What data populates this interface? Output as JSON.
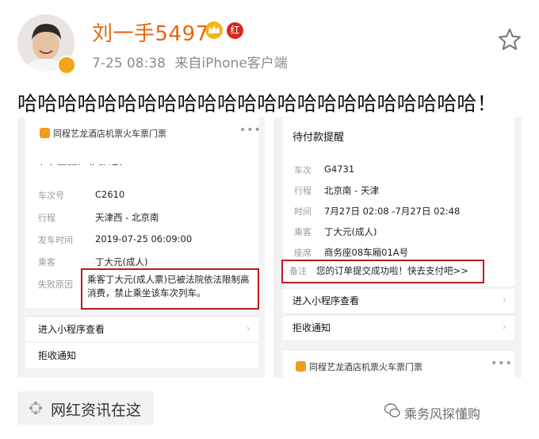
{
  "post": {
    "author_name": "刘一手5497",
    "red_badge": "红",
    "timestamp": "7-25 08:38",
    "source": "来自iPhone客户端",
    "text": "哈哈哈哈哈哈哈哈哈哈哈哈哈哈哈哈哈哈哈哈哈哈哈！"
  },
  "left_image": {
    "brand": "同程艺龙酒店机票火车票门票",
    "dots": "•••",
    "title": "火车票预订失败通知",
    "fields": [
      {
        "label": "车次号",
        "value": "C2610"
      },
      {
        "label": "行程",
        "value": "天津西 - 北京南"
      },
      {
        "label": "发车时间",
        "value": "2019-07-25 06:09:00"
      },
      {
        "label": "乘客",
        "value": "丁大元(成人)"
      },
      {
        "label": "失败原因",
        "value": "乘客丁大元(成人票)已被法院依法限制高消费，禁止乘坐该车次列车。"
      }
    ],
    "links": [
      "进入小程序查看",
      "拒收通知"
    ]
  },
  "right_image": {
    "title": "待付款提醒",
    "fields": [
      {
        "label": "车次",
        "value": "G4731"
      },
      {
        "label": "行程",
        "value": "北京南 - 天津"
      },
      {
        "label": "时间",
        "value": "7月27日 02:08 -7月27日 02:48"
      },
      {
        "label": "乘客",
        "value": "丁大元(成人)"
      },
      {
        "label": "座席",
        "value": "商务座08车厢01A号"
      },
      {
        "label": "备注",
        "value": "您的订单提交成功啦！快去支付吧>>"
      }
    ],
    "links": [
      "进入小程序查看",
      "拒收通知"
    ],
    "brand": "同程艺龙酒店机票火车票门票",
    "dots": "•••"
  },
  "footer": {
    "tag_label": "网红资讯在这",
    "watermark": "乘务风探懂购"
  },
  "colors": {
    "name": "#e8650d",
    "highlight_box": "#b71c1c",
    "meta": "#8c8c8c"
  },
  "icons": [
    "vip-crown-icon",
    "verified-badge-icon",
    "star-icon",
    "chevron-right-icon",
    "sparkle-icon",
    "wechat-icon"
  ]
}
